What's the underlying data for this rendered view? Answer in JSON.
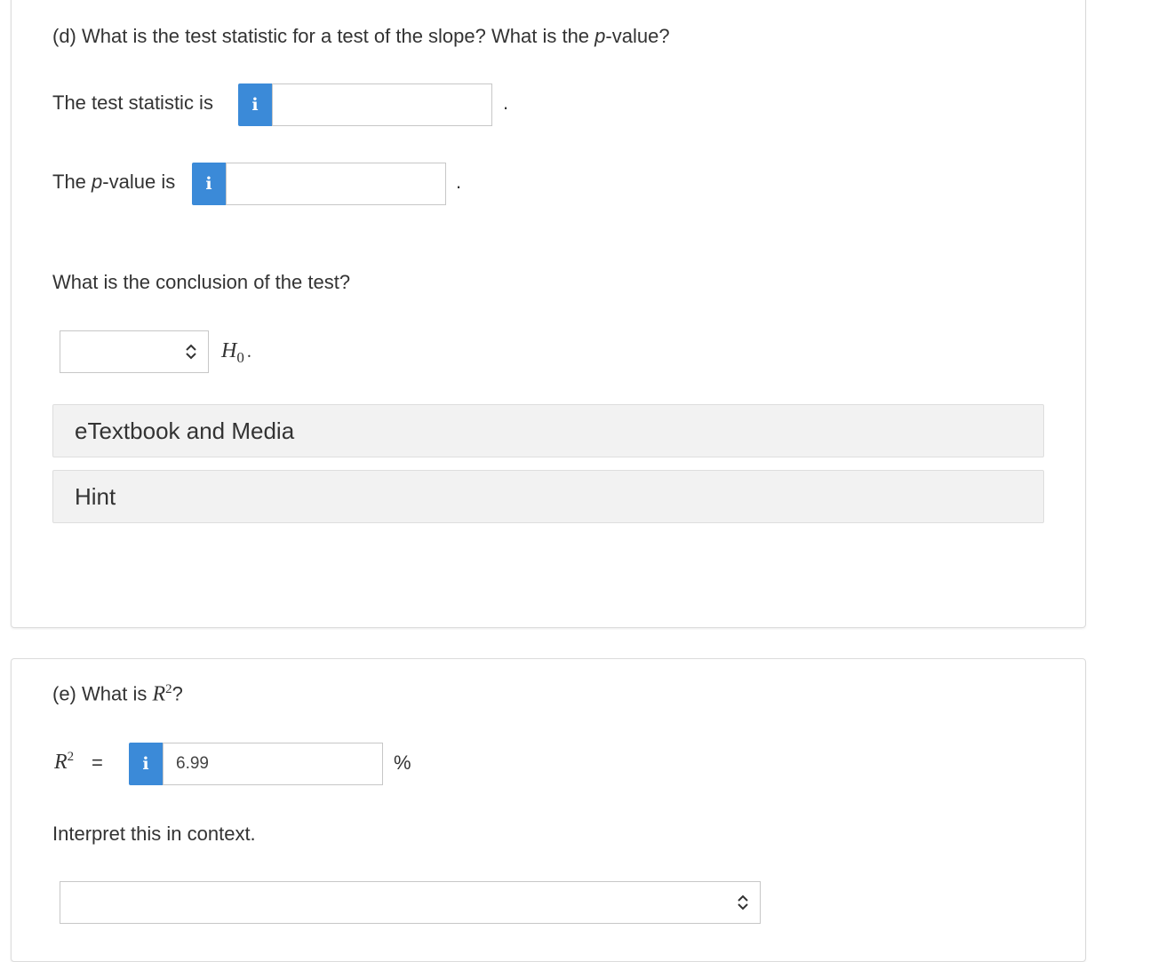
{
  "part_d": {
    "question_prefix": "(d) What is the test statistic for a test of the slope? What is the ",
    "question_p": "p",
    "question_suffix": "-value?",
    "test_stat_label": "The test statistic is",
    "test_stat_info": "i",
    "test_stat_value": "",
    "period": ".",
    "pvalue_label_pre": "The ",
    "pvalue_label_p": "p",
    "pvalue_label_post": "-value is",
    "pvalue_info": "i",
    "pvalue_value": "",
    "conclusion_question": "What is the conclusion of the test?",
    "conclusion_selected": "",
    "h0_H": "H",
    "h0_sub": "0",
    "h0_dot": ".",
    "etextbook_label": "eTextbook and Media",
    "hint_label": "Hint"
  },
  "part_e": {
    "question_prefix": "(e) What is ",
    "question_R": "R",
    "question_sup": "2",
    "question_suffix": "?",
    "r2_R": "R",
    "r2_sup": "2",
    "r2_equals": "=",
    "r2_info": "i",
    "r2_value": "6.99",
    "r2_unit": "%",
    "interpret_label": "Interpret this in context.",
    "interpret_selected": ""
  },
  "colors": {
    "info_button": "#3b8ad8",
    "accordion_bg": "#f2f2f2",
    "border": "#c7c7c7"
  },
  "icons": [
    "info-icon",
    "chevron-updown-icon"
  ]
}
